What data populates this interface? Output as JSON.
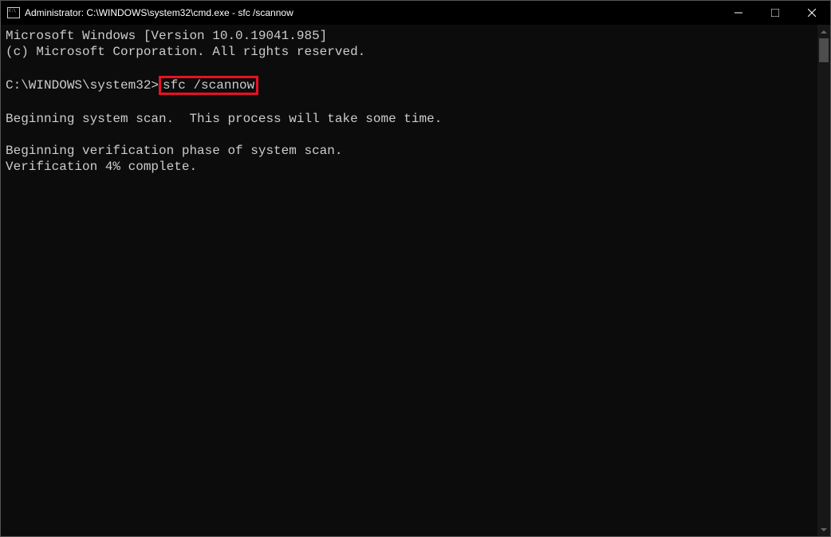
{
  "window": {
    "title": "Administrator: C:\\WINDOWS\\system32\\cmd.exe - sfc  /scannow"
  },
  "terminal": {
    "line1": "Microsoft Windows [Version 10.0.19041.985]",
    "line2": "(c) Microsoft Corporation. All rights reserved.",
    "prompt": "C:\\WINDOWS\\system32>",
    "command": "sfc /scannow",
    "line3": "Beginning system scan.  This process will take some time.",
    "line4": "Beginning verification phase of system scan.",
    "line5": "Verification 4% complete."
  }
}
